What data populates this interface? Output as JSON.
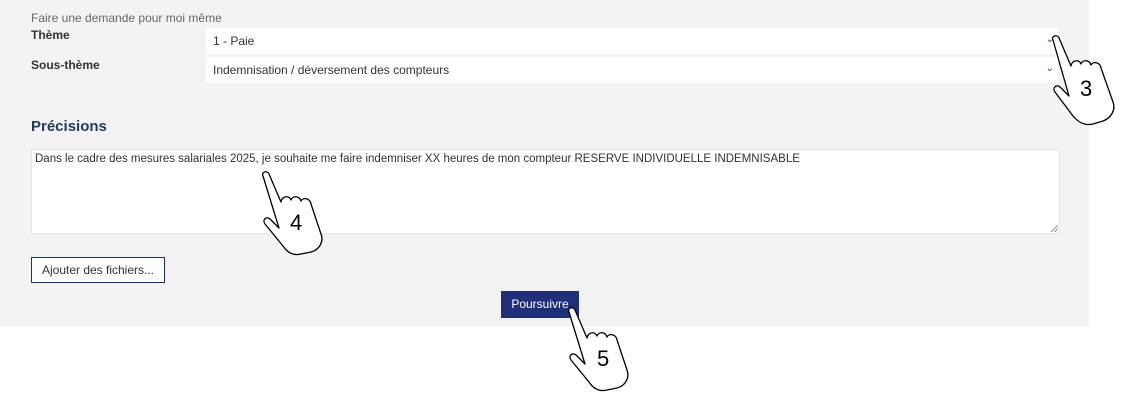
{
  "form": {
    "for_me_label": "Faire une demande pour moi même",
    "theme_label": "Thème",
    "theme_value": "1 - Paie",
    "subtheme_label": "Sous-thème",
    "subtheme_value": "Indemnisation / déversement des compteurs",
    "details_title": "Précisions",
    "details_text": "Dans le cadre des mesures salariales 2025, je souhaite me faire indemniser XX heures de mon compteur RESERVE INDIVIDUELLE INDEMNISABLE",
    "add_files_label": "Ajouter des fichiers...",
    "submit_label": "Poursuivre"
  },
  "annotations": {
    "step3": "3",
    "step4": "4",
    "step5": "5"
  },
  "colors": {
    "panel_bg": "#f3f3f3",
    "accent": "#1f2f7a",
    "title": "#1f3a5f"
  },
  "icons": [
    "chevron-down-icon",
    "hand-pointer-icon",
    "resize-grip-icon"
  ]
}
